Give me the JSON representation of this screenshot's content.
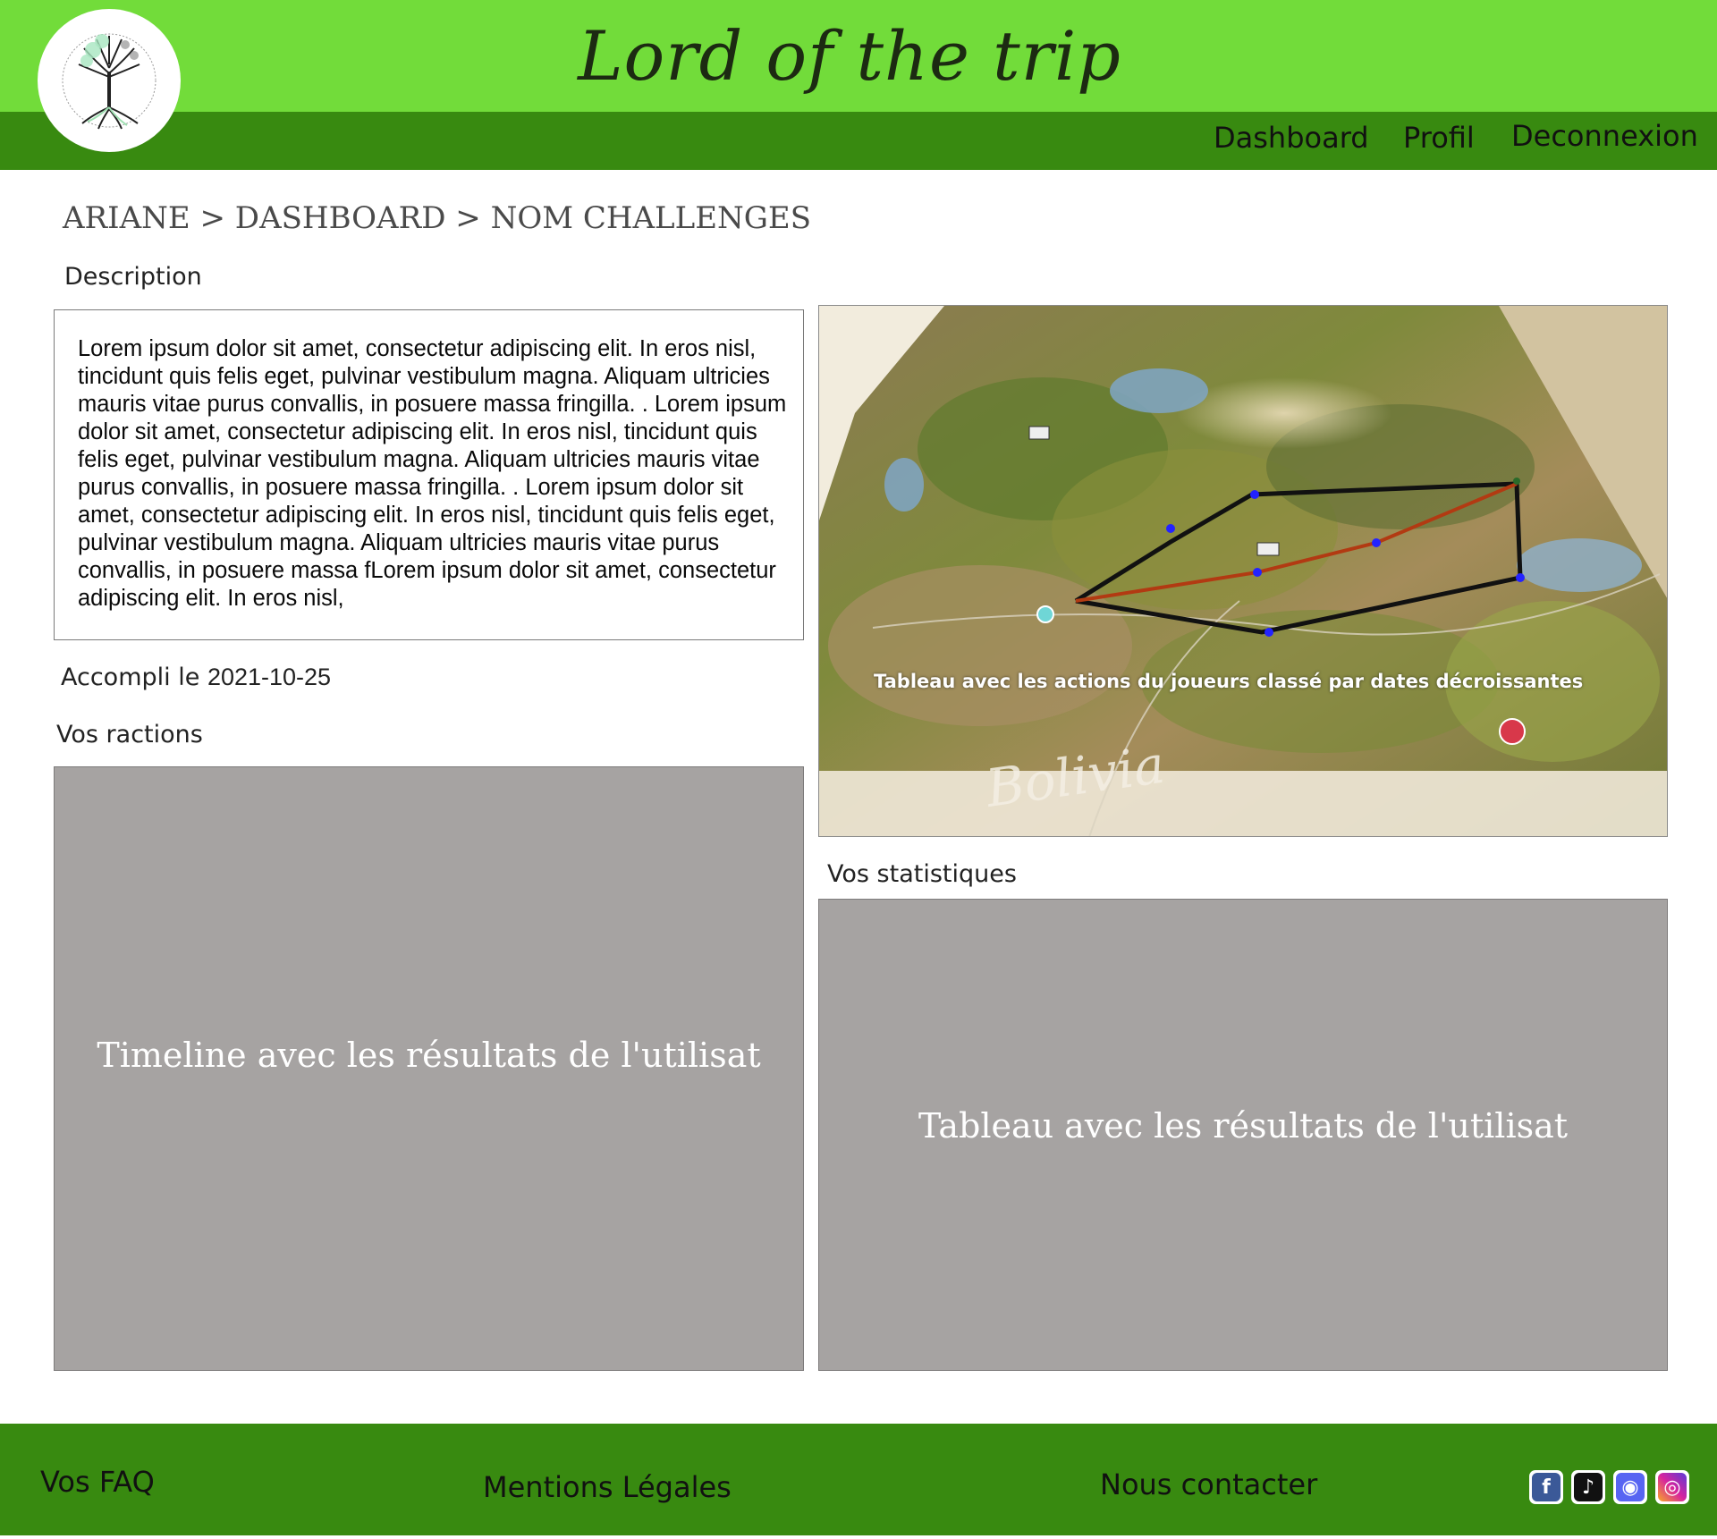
{
  "header": {
    "title": "Lord of the trip",
    "nav": [
      "Dashboard",
      "Profil",
      "Deconnexion"
    ]
  },
  "breadcrumb": "ARIANE > DASHBOARD > NOM CHALLENGES",
  "description": {
    "label": "Description",
    "text": "Lorem ipsum dolor sit amet, consectetur adipiscing elit. In eros nisl, tincidunt quis felis eget, pulvinar vestibulum magna. Aliquam ultricies mauris vitae purus convallis, in posuere massa fringilla. . Lorem ipsum dolor sit amet, consectetur adipiscing elit. In eros nisl, tincidunt quis felis eget, pulvinar vestibulum magna. Aliquam ultricies mauris vitae purus convallis, in posuere massa fringilla. . Lorem ipsum dolor sit amet, consectetur adipiscing elit. In eros nisl, tincidunt quis felis eget, pulvinar vestibulum magna. Aliquam ultricies mauris vitae purus convallis, in posuere massa fLorem ipsum dolor sit amet, consectetur adipiscing elit. In eros nisl,"
  },
  "completed": {
    "label": "Accompli le",
    "date": "2021-10-25"
  },
  "reactions": {
    "label": "Vos ractions",
    "placeholder": "Timeline avec les résultats de l'utilisat"
  },
  "map": {
    "caption": "Tableau avec les actions du joueurs classé par dates décroissantes",
    "region_text": "Bolivia"
  },
  "stats": {
    "label": "Vos statistiques",
    "placeholder": "Tableau avec les résultats de l'utilisat"
  },
  "footer": {
    "links": [
      "Vos FAQ",
      "Mentions Légales",
      "Nous contacter"
    ],
    "social": [
      {
        "icon": "facebook-icon",
        "glyph": "f",
        "color": "#3b5998"
      },
      {
        "icon": "tiktok-icon",
        "glyph": "♪",
        "color": "#111111"
      },
      {
        "icon": "discord-icon",
        "glyph": "◉",
        "color": "#5865f2"
      },
      {
        "icon": "instagram-icon",
        "glyph": "◎",
        "color": "#d6249f"
      }
    ]
  },
  "colors": {
    "header_light": "#72dc3a",
    "header_dark": "#388a10",
    "panel_grey": "#a6a3a2"
  }
}
